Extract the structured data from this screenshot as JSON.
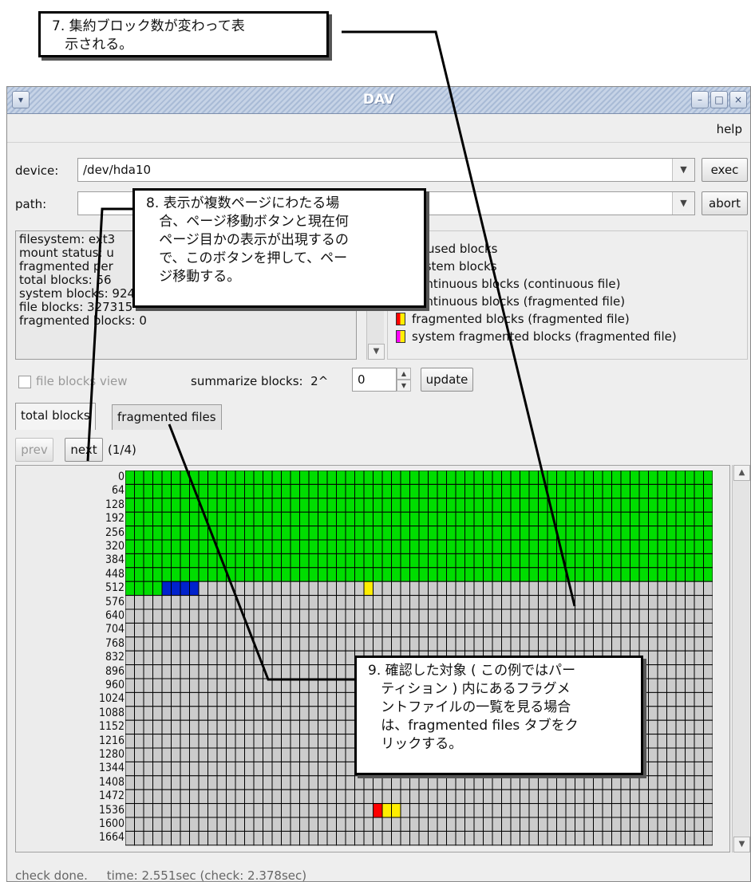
{
  "window": {
    "title": "DAV",
    "menu": {
      "help": "help"
    },
    "device": {
      "label": "device:",
      "value": "/dev/hda10",
      "exec": "exec"
    },
    "path": {
      "label": "path:",
      "value": "",
      "abort": "abort"
    },
    "info_lines": [
      "filesystem: ext3",
      "mount status: u",
      "fragmented per",
      "total blocks: 56",
      "system blocks: 9246",
      "file blocks: 327315",
      "fragmented blocks: 0"
    ],
    "legend": [
      {
        "label": "unused blocks",
        "color": "#cccccc"
      },
      {
        "label": "system blocks",
        "color": "#00dd00"
      },
      {
        "label": "continuous blocks (continuous file)",
        "color": "#0022cc"
      },
      {
        "label": "continuous blocks (fragmented file)",
        "color": "#ffee00"
      },
      {
        "label": "fragmented blocks (fragmented file)",
        "color": "#ffee00",
        "accent": "#ff0000"
      },
      {
        "label": "system fragmented blocks (fragmented file)",
        "color": "#ffee00",
        "accent": "#ff00ff"
      }
    ],
    "options": {
      "file_blocks_view": "file blocks view",
      "summarize_label": "summarize blocks:  2^",
      "summarize_value": "0",
      "update": "update"
    },
    "tabs": {
      "total_blocks": "total blocks",
      "fragmented_files": "fragmented files"
    },
    "pager": {
      "prev": "prev",
      "next": "next",
      "page": "(1/4)"
    },
    "grid": {
      "row_labels": [
        "0",
        "64",
        "128",
        "192",
        "256",
        "320",
        "384",
        "448",
        "512",
        "576",
        "640",
        "704",
        "768",
        "832",
        "896",
        "960",
        "1024",
        "1088",
        "1152",
        "1216",
        "1280",
        "1344",
        "1408",
        "1472",
        "1536",
        "1600",
        "1664"
      ],
      "columns": 64,
      "system_rows": 8,
      "row512_system_cells": 4,
      "row512_blue_cells": [
        4,
        5,
        6,
        7
      ],
      "row512_yellow_cells": [
        26
      ],
      "row1536_red_cells": [
        27
      ],
      "row1536_yellow_cells": [
        28,
        29
      ],
      "colors": {
        "unused": "#cccccc",
        "system": "#00dd00",
        "continuous": "#0022cc",
        "fragfile": "#ffee00",
        "fragmented": "#ff0000"
      }
    },
    "status": "check done.     time: 2.551sec (check: 2.378sec)"
  },
  "callouts": {
    "c7": "7. 集約ブロック数が変わって表\n   示される。",
    "c8": "8. 表示が複数ページにわたる場\n   合、ページ移動ボタンと現在何\n   ページ目かの表示が出現するの\n   で、このボタンを押して、ペー\n   ジ移動する。",
    "c9": "9. 確認した対象 ( この例ではパー\n   ティション ) 内にあるフラグメ\n   ントファイルの一覧を見る場合\n   は、fragmented files タブをク\n   リックする。"
  }
}
